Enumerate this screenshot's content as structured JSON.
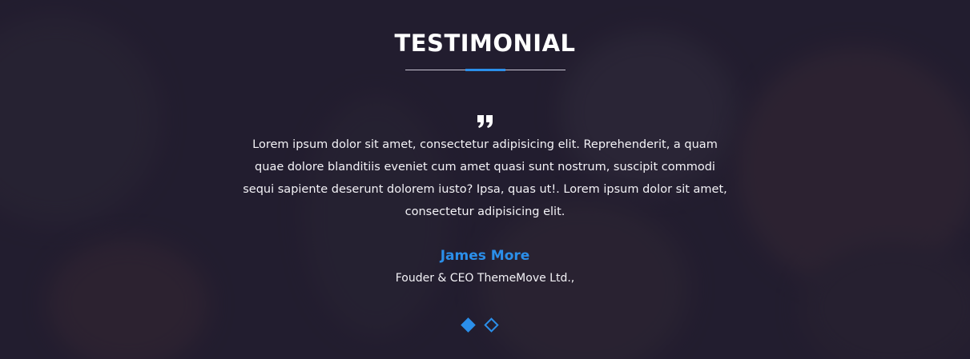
{
  "section": {
    "title": "TESTIMONIAL"
  },
  "testimonial": {
    "quote_icon": "quote-icon",
    "text": "Lorem ipsum dolor sit amet, consectetur adipisicing elit. Reprehenderit, a quam quae dolore blanditiis eveniet cum amet quasi sunt nostrum, suscipit commodi sequi sapiente deserunt dolorem iusto? Ipsa, quas ut!. Lorem ipsum dolor sit amet, consectetur adipisicing elit.",
    "author": "James More",
    "role": "Fouder & CEO ThemeMove Ltd.,"
  },
  "pagination": {
    "total": 2,
    "active_index": 0
  },
  "colors": {
    "accent": "#2b8fea",
    "background": "#252031",
    "text": "#ffffff"
  }
}
